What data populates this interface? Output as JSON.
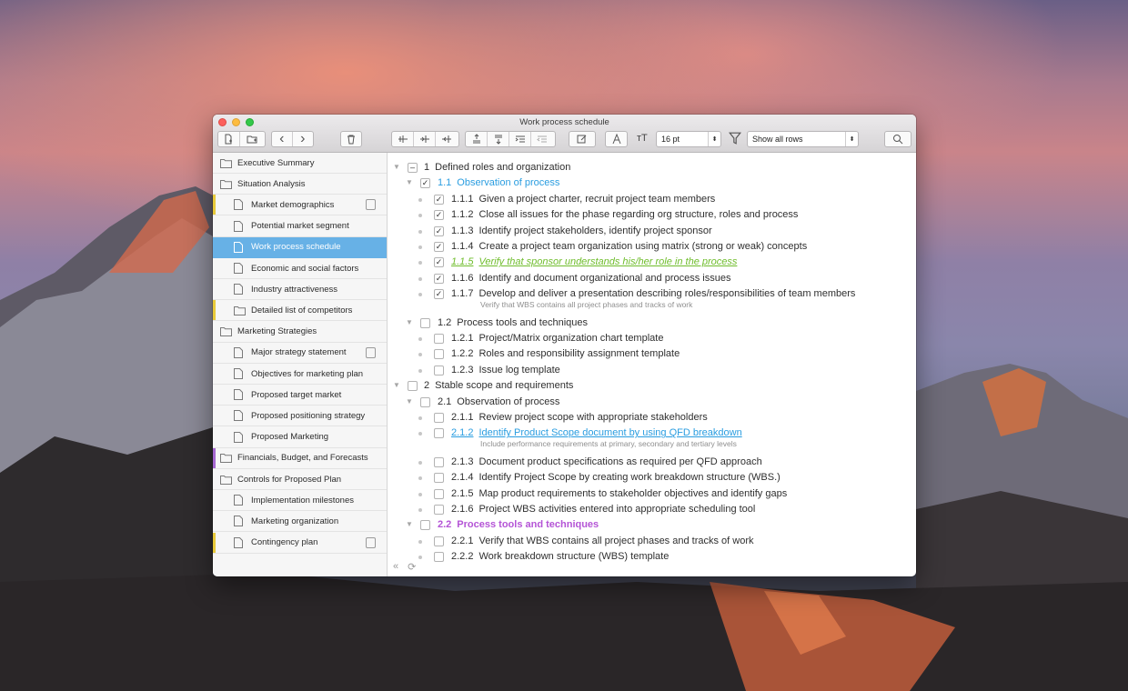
{
  "window": {
    "title": "Work process schedule"
  },
  "toolbar": {
    "font_size": "16 pt",
    "filter_value": "Show all rows"
  },
  "sidebar": {
    "items": [
      {
        "label": "Executive Summary",
        "level": 0,
        "type": "folder"
      },
      {
        "label": "Situation Analysis",
        "level": 0,
        "type": "folder"
      },
      {
        "label": "Market demographics",
        "level": 1,
        "type": "doc",
        "locked": true,
        "bar": "#e8c93a"
      },
      {
        "label": "Potential market segment",
        "level": 1,
        "type": "doc"
      },
      {
        "label": "Work process schedule",
        "level": 1,
        "type": "doc",
        "selected": true
      },
      {
        "label": "Economic and social factors",
        "level": 1,
        "type": "doc"
      },
      {
        "label": "Industry attractiveness",
        "level": 1,
        "type": "doc"
      },
      {
        "label": "Detailed list of competitors",
        "level": 1,
        "type": "folder",
        "bar": "#e8c93a"
      },
      {
        "label": "Marketing Strategies",
        "level": 0,
        "type": "folder"
      },
      {
        "label": "Major strategy statement",
        "level": 1,
        "type": "doc",
        "locked": true
      },
      {
        "label": "Objectives for marketing plan",
        "level": 1,
        "type": "doc"
      },
      {
        "label": "Proposed target market",
        "level": 1,
        "type": "doc"
      },
      {
        "label": "Proposed positioning strategy",
        "level": 1,
        "type": "doc"
      },
      {
        "label": "Proposed Marketing",
        "level": 1,
        "type": "doc"
      },
      {
        "label": "Financials, Budget, and Forecasts",
        "level": 0,
        "type": "folder",
        "bar": "#a567d0"
      },
      {
        "label": "Controls for Proposed Plan",
        "level": 0,
        "type": "folder"
      },
      {
        "label": "Implementation milestones",
        "level": 1,
        "type": "doc"
      },
      {
        "label": "Marketing organization",
        "level": 1,
        "type": "doc"
      },
      {
        "label": "Contingency plan",
        "level": 1,
        "type": "doc",
        "locked": true,
        "bar": "#e8c93a"
      }
    ],
    "search_placeholder": "Search"
  },
  "outline": {
    "rows": [
      {
        "num": "1",
        "text": "Defined roles and organization",
        "level": 0,
        "check": "mixed",
        "style": ""
      },
      {
        "num": "1.1",
        "text": "Observation of process",
        "level": 1,
        "check": "checked",
        "style": "blue"
      },
      {
        "num": "1.1.1",
        "text": "Given a project charter, recruit project team members",
        "level": 2,
        "check": "checked",
        "style": ""
      },
      {
        "num": "1.1.2",
        "text": "Close all issues for the phase regarding org structure, roles and process",
        "level": 2,
        "check": "checked",
        "style": ""
      },
      {
        "num": "1.1.3",
        "text": "Identify project stakeholders, identify project sponsor",
        "level": 2,
        "check": "checked",
        "style": ""
      },
      {
        "num": "1.1.4",
        "text": "Create a project team organization using matrix (strong or weak) concepts",
        "level": 2,
        "check": "checked",
        "style": ""
      },
      {
        "num": "1.1.5",
        "text": "Verify that sponsor understands his/her role in the process",
        "level": 2,
        "check": "checked",
        "style": "green"
      },
      {
        "num": "1.1.6",
        "text": "Identify and document organizational and process issues",
        "level": 2,
        "check": "checked",
        "style": ""
      },
      {
        "num": "1.1.7",
        "text": "Develop and deliver a presentation describing roles/responsibilities of team members",
        "level": 2,
        "check": "checked",
        "style": "",
        "note": "Verify that WBS contains all project phases and tracks of work"
      },
      {
        "num": "1.2",
        "text": "Process tools and techniques",
        "level": 1,
        "check": "empty",
        "style": ""
      },
      {
        "num": "1.2.1",
        "text": "Project/Matrix organization chart template",
        "level": 2,
        "check": "empty",
        "style": ""
      },
      {
        "num": "1.2.2",
        "text": "Roles and responsibility assignment template",
        "level": 2,
        "check": "empty",
        "style": ""
      },
      {
        "num": "1.2.3",
        "text": "Issue log template",
        "level": 2,
        "check": "empty",
        "style": ""
      },
      {
        "num": "2",
        "text": "Stable scope and requirements",
        "level": 0,
        "check": "empty",
        "style": ""
      },
      {
        "num": "2.1",
        "text": "Observation of process",
        "level": 1,
        "check": "empty",
        "style": ""
      },
      {
        "num": "2.1.1",
        "text": "Review project scope with appropriate stakeholders",
        "level": 2,
        "check": "empty",
        "style": ""
      },
      {
        "num": "2.1.2",
        "text": "Identify Product Scope document by using QFD breakdown",
        "level": 2,
        "check": "empty",
        "style": "link",
        "note": "Include performance requirements at primary, secondary and tertiary levels"
      },
      {
        "num": "2.1.3",
        "text": "Document product specifications as required per QFD approach",
        "level": 2,
        "check": "empty",
        "style": ""
      },
      {
        "num": "2.1.4",
        "text": "Identify Project Scope by creating work breakdown structure (WBS.)",
        "level": 2,
        "check": "empty",
        "style": ""
      },
      {
        "num": "2.1.5",
        "text": "Map product requirements to stakeholder objectives and identify gaps",
        "level": 2,
        "check": "empty",
        "style": ""
      },
      {
        "num": "2.1.6",
        "text": "Project WBS activities entered into appropriate scheduling tool",
        "level": 2,
        "check": "empty",
        "style": ""
      },
      {
        "num": "2.2",
        "text": "Process tools and techniques",
        "level": 1,
        "check": "empty",
        "style": "purple"
      },
      {
        "num": "2.2.1",
        "text": "Verify that WBS contains all project phases and tracks of work",
        "level": 2,
        "check": "empty",
        "style": ""
      },
      {
        "num": "2.2.2",
        "text": "Work breakdown structure (WBS) template",
        "level": 2,
        "check": "empty",
        "style": ""
      }
    ]
  },
  "colors": {
    "selection": "#67b1e6",
    "blue_text": "#2a9de0",
    "green_text": "#6fbd2c",
    "purple_text": "#b454d6"
  }
}
